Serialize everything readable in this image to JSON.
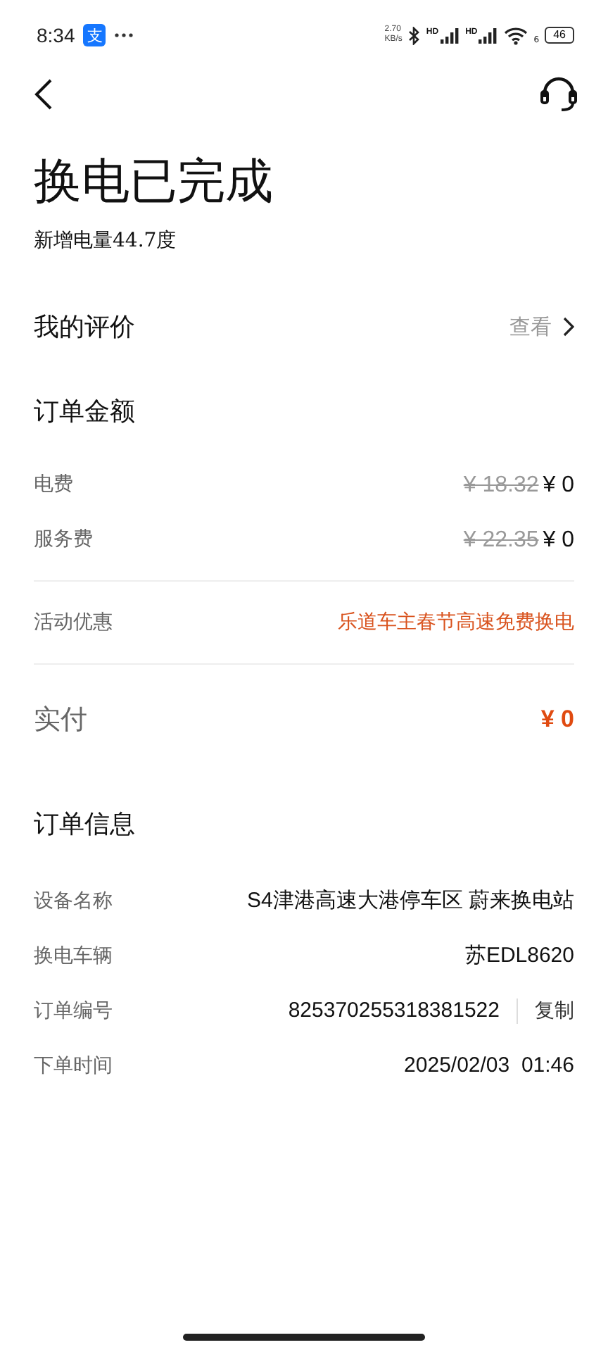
{
  "status_bar": {
    "time": "8:34",
    "app_badge": "支",
    "speed_value": "2.70",
    "speed_unit": "KB/s",
    "sim_labels": [
      "HD",
      "HD"
    ],
    "wifi_label": "6",
    "battery": "46"
  },
  "title": "换电已完成",
  "subtitle": "新增电量44.7度",
  "review": {
    "label": "我的评价",
    "action": "查看"
  },
  "amount": {
    "heading": "订单金额",
    "fees": [
      {
        "label": "电费",
        "original": "¥ 18.32",
        "price": "¥ 0"
      },
      {
        "label": "服务费",
        "original": "¥ 22.35",
        "price": "¥ 0"
      }
    ],
    "promotion": {
      "label": "活动优惠",
      "value": "乐道车主春节高速免费换电"
    },
    "paid": {
      "label": "实付",
      "value": "¥ 0"
    }
  },
  "info": {
    "heading": "订单信息",
    "rows": [
      {
        "kind": "text",
        "label": "设备名称",
        "value": "S4津港高速大港停车区 蔚来换电站"
      },
      {
        "kind": "text",
        "label": "换电车辆",
        "value": "苏EDL8620"
      },
      {
        "kind": "copy",
        "label": "订单编号",
        "value": "825370255318381522",
        "action": "复制"
      },
      {
        "kind": "text",
        "label": "下单时间",
        "value": "2025/02/03  01:46"
      }
    ]
  }
}
